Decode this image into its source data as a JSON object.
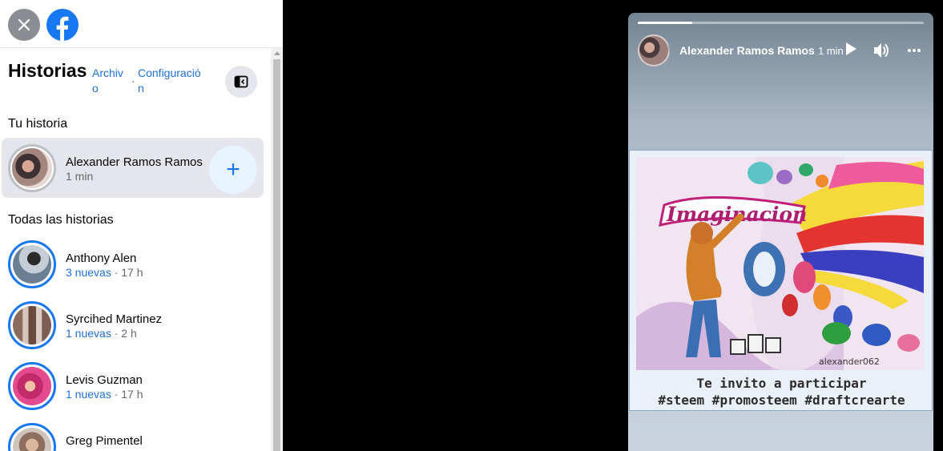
{
  "sidebar": {
    "title": "Historias",
    "archive_link": "Archivo",
    "settings_link": "Configuración",
    "separator": "·",
    "your_story_heading": "Tu historia",
    "all_stories_heading": "Todas las historias",
    "my_story": {
      "name": "Alexander Ramos Ramos",
      "time": "1 min"
    },
    "add_icon": "+",
    "stories": [
      {
        "name": "Anthony Alen",
        "count": "3 nuevas",
        "time": " · 17 h"
      },
      {
        "name": "Syrcihed Martinez",
        "count": "1 nuevas",
        "time": " · 2 h"
      },
      {
        "name": "Levis Guzman",
        "count": "1 nuevas",
        "time": " · 17 h"
      },
      {
        "name": "Greg Pimentel",
        "count": "",
        "time": ""
      }
    ]
  },
  "viewer": {
    "author": "Alexander Ramos Ramos",
    "time": "1 min",
    "progress": 0.19,
    "watermark": "alexander062",
    "art_title": "Imaginacion",
    "caption_line1": "Te invito a participar",
    "caption_line2": "#steem #promosteem #draftcrearte"
  },
  "icons": [
    "close-icon",
    "facebook-logo-icon",
    "panel-toggle-icon",
    "add-icon",
    "play-icon",
    "volume-icon",
    "more-icon"
  ],
  "colors": {
    "accent": "#1877f2",
    "link": "#216fdb",
    "background": "#000000"
  }
}
